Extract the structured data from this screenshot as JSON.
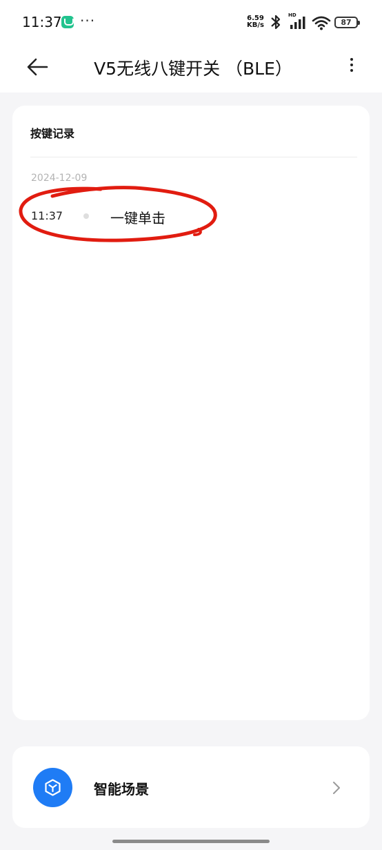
{
  "status_bar": {
    "time": "11:37",
    "more": "···",
    "net_speed_value": "6.59",
    "net_speed_unit": "KB/s",
    "signal_badge": "HD",
    "battery": "87"
  },
  "header": {
    "title": "V5无线八键开关 （BLE）"
  },
  "record_card": {
    "title": "按键记录",
    "records": [
      {
        "date": "2024-12-09",
        "time": "11:37",
        "action": "一键单击"
      }
    ]
  },
  "scene_card": {
    "label": "智能场景",
    "icon": "cube-icon"
  },
  "colors": {
    "accent": "#1f7cf5",
    "annotation": "#e11c10",
    "background": "#f5f5f7"
  }
}
